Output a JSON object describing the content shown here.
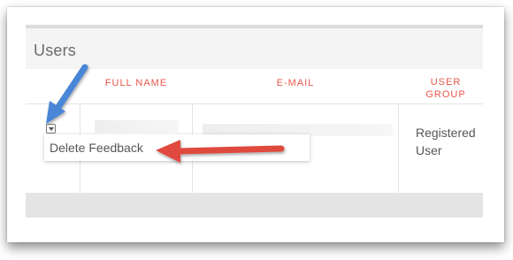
{
  "panel": {
    "title": "Users"
  },
  "table": {
    "columns": [
      {
        "label": "FULL NAME"
      },
      {
        "label": "E-MAIL"
      },
      {
        "label_line1": "USER",
        "label_line2": "GROUP"
      }
    ],
    "rows": [
      {
        "full_name": "",
        "email": "",
        "user_group_line1": "Registered",
        "user_group_line2": "User"
      }
    ]
  },
  "context_menu": {
    "items": [
      "Delete Feedback"
    ]
  },
  "annotations": {
    "blue_arrow_color": "#4a86d8",
    "red_arrow_color": "#e04a3c"
  },
  "icons": {
    "row_action": "dropdown-caret-icon"
  }
}
